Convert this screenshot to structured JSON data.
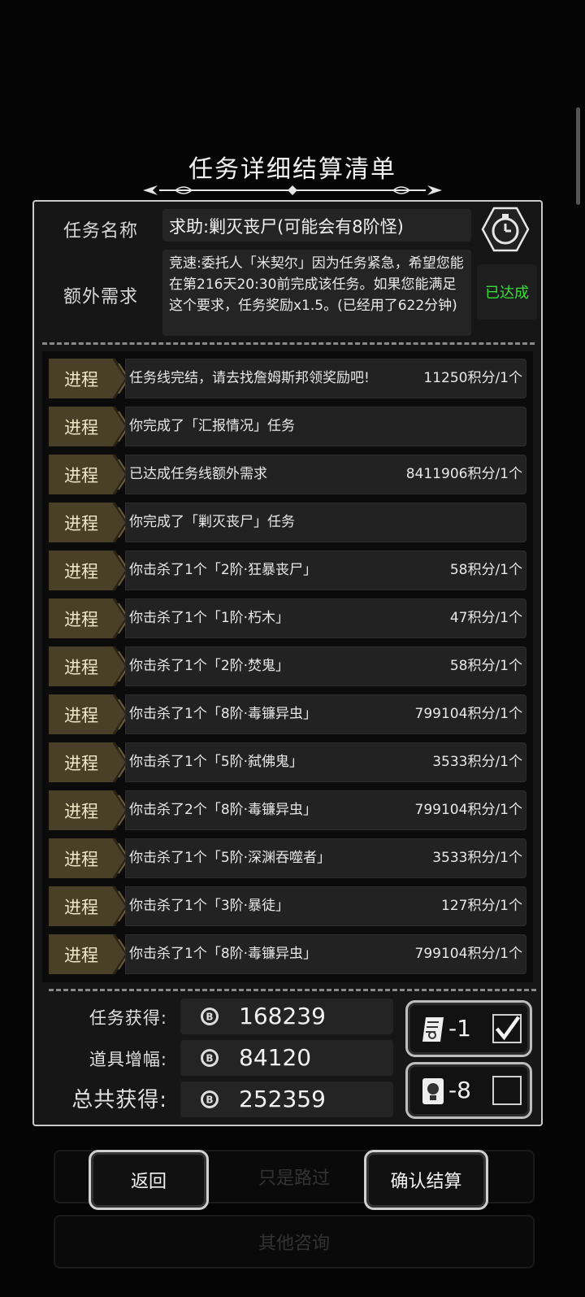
{
  "background": {
    "buttons": [
      "只是路过",
      "其他咨询"
    ]
  },
  "title": "任务详细结算清单",
  "task": {
    "name_label": "任务名称",
    "name_value": "求助:剿灭丧尸(可能会有8阶怪)",
    "extra_label": "额外需求",
    "extra_value": "竞速:委托人「米契尔」因为任务紧急，希望您能在第216天20:30前完成该任务。如果您能满足这个要求，任务奖励x1.5。(已经用了622分钟)",
    "extra_status": "已达成",
    "status_color": "#35e035"
  },
  "progress_tag": "进程",
  "rows": [
    {
      "desc": "任务线完结，请去找詹姆斯邦领奖励吧!",
      "value": "11250积分/1个"
    },
    {
      "desc": "你完成了「汇报情况」任务",
      "value": ""
    },
    {
      "desc": "已达成任务线额外需求",
      "value": "8411906积分/1个"
    },
    {
      "desc": "你完成了「剿灭丧尸」任务",
      "value": ""
    },
    {
      "desc": "你击杀了1个「2阶·狂暴丧尸」",
      "value": "58积分/1个"
    },
    {
      "desc": "你击杀了1个「1阶·朽木」",
      "value": "47积分/1个"
    },
    {
      "desc": "你击杀了1个「2阶·焚鬼」",
      "value": "58积分/1个"
    },
    {
      "desc": "你击杀了1个「8阶·毒镰异虫」",
      "value": "799104积分/1个"
    },
    {
      "desc": "你击杀了1个「5阶·弑佛鬼」",
      "value": "3533积分/1个"
    },
    {
      "desc": "你击杀了2个「8阶·毒镰异虫」",
      "value": "799104积分/1个"
    },
    {
      "desc": "你击杀了1个「5阶·深渊吞噬者」",
      "value": "3533积分/1个"
    },
    {
      "desc": "你击杀了1个「3阶·暴徒」",
      "value": "127积分/1个"
    },
    {
      "desc": "你击杀了1个「8阶·毒镰异虫」",
      "value": "799104积分/1个"
    }
  ],
  "summary": {
    "task_label": "任务获得:",
    "task_value": "168239",
    "item_label": "道具增幅:",
    "item_value": "84120",
    "total_label": "总共获得:",
    "total_value": "252359"
  },
  "options": {
    "scroll_value": "-1",
    "scroll_checked": true,
    "card_value": "-8",
    "card_checked": false
  },
  "buttons": {
    "back": "返回",
    "confirm": "确认结算"
  }
}
